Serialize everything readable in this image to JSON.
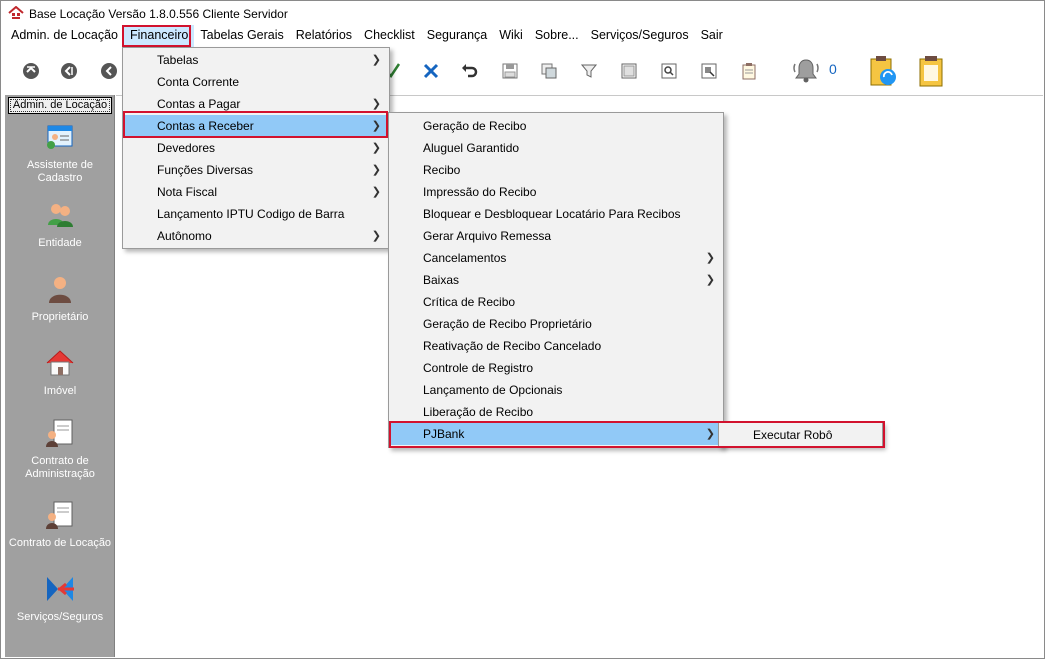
{
  "window": {
    "title": "Base Locação Versão 1.8.0.556 Cliente Servidor"
  },
  "menubar": {
    "items": [
      {
        "label": "Admin. de Locação"
      },
      {
        "label": "Financeiro"
      },
      {
        "label": "Tabelas Gerais"
      },
      {
        "label": "Relatórios"
      },
      {
        "label": "Checklist"
      },
      {
        "label": "Segurança"
      },
      {
        "label": "Wiki"
      },
      {
        "label": "Sobre..."
      },
      {
        "label": "Serviços/Seguros"
      },
      {
        "label": "Sair"
      }
    ]
  },
  "toolbar": {
    "notification_count": "0"
  },
  "sidebar": {
    "header": "Admin. de Locação",
    "items": [
      {
        "label": "Assistente de Cadastro"
      },
      {
        "label": "Entidade"
      },
      {
        "label": "Proprietário"
      },
      {
        "label": "Imóvel"
      },
      {
        "label": "Contrato de Administração"
      },
      {
        "label": "Contrato de Locação"
      },
      {
        "label": "Serviços/Seguros"
      }
    ]
  },
  "financeiro_menu": {
    "items": [
      {
        "label": "Tabelas"
      },
      {
        "label": "Conta Corrente"
      },
      {
        "label": "Contas a Pagar"
      },
      {
        "label": "Contas a Receber"
      },
      {
        "label": "Devedores"
      },
      {
        "label": "Funções Diversas"
      },
      {
        "label": "Nota Fiscal"
      },
      {
        "label": "Lançamento IPTU Codigo de Barra"
      },
      {
        "label": "Autônomo"
      }
    ]
  },
  "contas_receber_menu": {
    "items": [
      {
        "label": "Geração de Recibo"
      },
      {
        "label": "Aluguel Garantido"
      },
      {
        "label": "Recibo"
      },
      {
        "label": "Impressão do Recibo"
      },
      {
        "label": "Bloquear e Desbloquear Locatário Para Recibos"
      },
      {
        "label": "Gerar Arquivo Remessa"
      },
      {
        "label": "Cancelamentos"
      },
      {
        "label": "Baixas"
      },
      {
        "label": "Crítica de Recibo"
      },
      {
        "label": "Geração de Recibo Proprietário"
      },
      {
        "label": "Reativação de Recibo Cancelado"
      },
      {
        "label": "Controle de Registro"
      },
      {
        "label": "Lançamento de Opcionais"
      },
      {
        "label": "Liberação de Recibo"
      },
      {
        "label": "PJBank"
      }
    ]
  },
  "pjbank_menu": {
    "items": [
      {
        "label": "Executar Robô"
      }
    ]
  },
  "colors": {
    "highlight": "#91c9f7",
    "annotation_red": "#d2122e",
    "sidebar_bg": "#a0a0a0"
  }
}
